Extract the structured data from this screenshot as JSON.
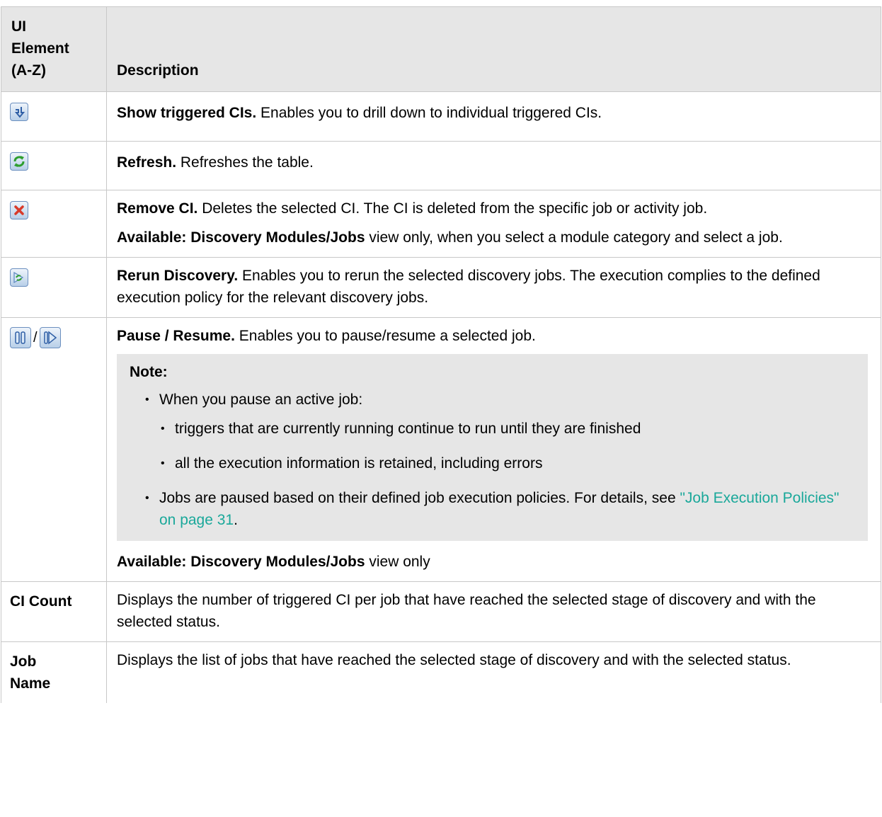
{
  "table": {
    "header": {
      "col1_line1": "UI",
      "col1_line2": "Element",
      "col1_line3": "(A-Z)",
      "col2": "Description"
    },
    "rows": {
      "show_triggered": {
        "icon": "show-triggered-cis-icon",
        "title": "Show triggered CIs.",
        "text": " Enables you to drill down to individual triggered CIs."
      },
      "refresh": {
        "icon": "refresh-icon",
        "title": "Refresh.",
        "text": " Refreshes the table."
      },
      "remove_ci": {
        "icon": "remove-ci-icon",
        "title": "Remove CI.",
        "text": " Deletes the selected CI. The CI is deleted from the specific job or activity job.",
        "avail_label": "Available: Discovery Modules/Jobs",
        "avail_text": " view only, when you select a module category and select a job."
      },
      "rerun": {
        "icon": "rerun-discovery-icon",
        "title": "Rerun Discovery.",
        "text": " Enables you to rerun the selected discovery jobs. The execution complies to the defined execution policy for the relevant discovery jobs."
      },
      "pause_resume": {
        "icons": [
          "pause-icon",
          "resume-icon"
        ],
        "separator": "/",
        "title": "Pause / Resume.",
        "text": " Enables you to pause/resume a selected job.",
        "note_label": "Note:",
        "bullet1": "When you pause an active job:",
        "sub1": "triggers that are currently running continue to run until they are finished",
        "sub2": "all the execution information is retained, including errors",
        "bullet2_text": "Jobs are paused based on their defined job execution policies. For details, see ",
        "bullet2_link": "\"Job Execution Policies\" on page 31",
        "bullet2_end": ".",
        "avail_label": "Available: Discovery Modules/Jobs",
        "avail_text": " view only"
      },
      "ci_count": {
        "element": "CI Count",
        "text": "Displays the number of triggered CI per job that have reached the selected stage of discovery and with the selected status."
      },
      "job_name": {
        "element_line1": "Job",
        "element_line2": "Name",
        "text": "Displays the list of jobs that have reached the selected stage of discovery and with the selected status."
      }
    }
  },
  "colors": {
    "header_bg": "#e6e6e6",
    "note_bg": "#e6e6e6",
    "link": "#1aa89a",
    "border": "#c8c8c8"
  }
}
